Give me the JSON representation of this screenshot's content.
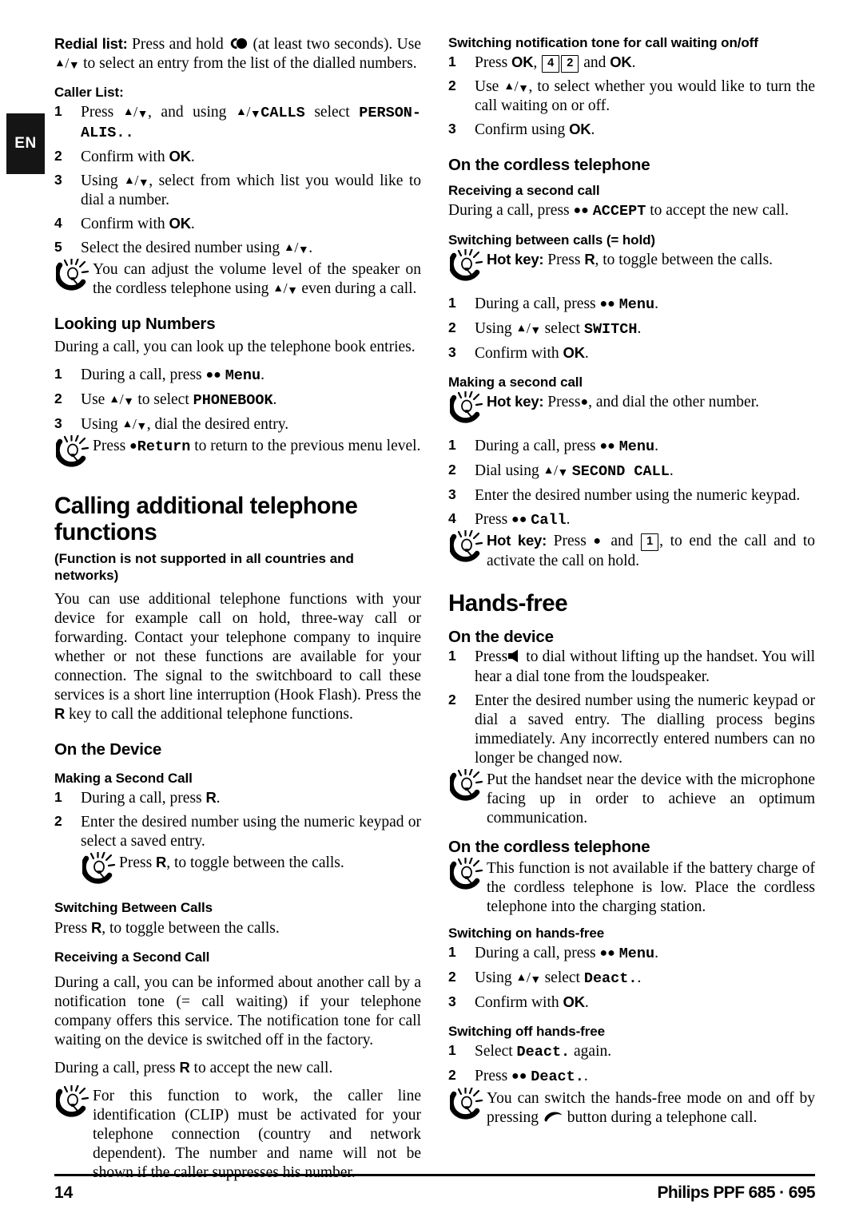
{
  "language_tab": "EN",
  "footer": {
    "page_number": "14",
    "brand": "Philips PPF 685 · 695"
  },
  "icons": {
    "bulb": "lightbulb-tip-icon",
    "redial": "redial-icon",
    "speaker": "loudspeaker-icon",
    "handset": "handset-icon"
  },
  "left_column": {
    "redial": {
      "label": "Redial list:",
      "text_before_icon": " Press and hold ",
      "text_after_icon": " (at least two seconds). Use ",
      "text_tail": " to select an entry from the list of the dialled numbers."
    },
    "caller_list": {
      "heading": "Caller List:",
      "steps": [
        {
          "num": "1",
          "parts": [
            "Press ",
            "UPDOWN",
            ", and using ",
            "UPDOWN",
            "CALLS",
            " select ",
            "PERSON-ALIS.."
          ]
        },
        {
          "num": "2",
          "text": "Confirm with ",
          "bold": "OK",
          "tail": "."
        },
        {
          "num": "3",
          "text": "Using ",
          "tail": ", select from which list you would like to dial a number."
        },
        {
          "num": "4",
          "text": "Confirm with ",
          "bold": "OK",
          "tail": "."
        },
        {
          "num": "5",
          "text": "Select the desired number using ",
          "tail": "."
        }
      ],
      "tip": {
        "part1": "You can adjust the volume level of the speaker on the cordless telephone using ",
        "part2": " even during a call."
      }
    },
    "looking_up_numbers": {
      "heading": "Looking up Numbers",
      "intro": "During a call, you can look up the telephone book entries.",
      "steps": [
        {
          "num": "1",
          "text": "During a call, press ",
          "display": "Menu",
          "tail": "."
        },
        {
          "num": "2",
          "text": "Use ",
          "mid": " to select ",
          "display": "PHONEBOOK",
          "tail": "."
        },
        {
          "num": "3",
          "text": "Using ",
          "tail": ", dial the desired entry."
        }
      ],
      "tip": {
        "before": "Press ",
        "display": "Return",
        "after": " to return to the previous menu level."
      }
    },
    "calling_additional": {
      "heading": "Calling additional telephone functions",
      "subheading": "(Function is not supported in all countries and networks)",
      "body": "You can use additional telephone functions with your device for example call on hold, three-way call or forwarding. Contact your telephone company to inquire whether or not these functions are available for your connection. The signal to the switchboard to call these services is a short line interruption (Hook Flash). Press the ",
      "body_bold": "R",
      "body_tail": " key to call the additional telephone functions."
    },
    "on_the_device": {
      "heading": "On the Device",
      "making_second_call": {
        "heading": "Making a Second Call",
        "steps": [
          {
            "num": "1",
            "text": "During a call, press ",
            "bold": "R",
            "tail": "."
          },
          {
            "num": "2",
            "text": "Enter the desired number using the numeric keypad or select a saved entry."
          }
        ],
        "tip": {
          "before": "Press ",
          "bold": "R",
          "after": ", to toggle between the calls."
        }
      },
      "switching_between_calls": {
        "heading": "Switching Between Calls",
        "text_before": "Press ",
        "bold": "R",
        "text_after": ", to toggle between the calls."
      },
      "receiving_second_call": {
        "heading": "Receiving a Second Call",
        "para1": "During a call, you can be informed about another call by a notification tone (= call waiting) if your telephone company offers this service. The notification tone for call waiting on the device is switched off in the factory.",
        "para2_before": "During a call, press ",
        "para2_bold": "R",
        "para2_after": " to accept the new call.",
        "tip": "For this function to work, the caller line identification (CLIP) must be activated for your telephone connection (country and network dependent). The number and name will not be shown if the caller suppresses his number."
      }
    }
  },
  "right_column": {
    "switching_notification_tone": {
      "heading": "Switching notification tone for call waiting on/off",
      "steps": [
        {
          "num": "1",
          "text": "Press ",
          "bold1": "OK",
          "comma": ", ",
          "key1": "4",
          "key2": "2",
          "mid": " and ",
          "bold2": "OK",
          "tail": "."
        },
        {
          "num": "2",
          "text": "Use ",
          "tail": ", to select whether you would like to turn the call waiting on or off."
        },
        {
          "num": "3",
          "text": "Confirm using ",
          "bold": "OK",
          "tail": "."
        }
      ]
    },
    "on_the_cordless_telephone_1": {
      "heading": "On the cordless telephone",
      "receiving_second_call": {
        "heading": "Receiving a second call",
        "text_before": "During a call, press ",
        "display": "ACCEPT",
        "text_after": " to accept the new call."
      },
      "switching_between_calls": {
        "heading": "Switching between calls (= hold)",
        "tip": {
          "label": "Hot key:",
          "before": " Press ",
          "bold": "R",
          "after": ", to toggle between the calls."
        },
        "steps": [
          {
            "num": "1",
            "text": "During a call, press ",
            "display": "Menu",
            "tail": "."
          },
          {
            "num": "2",
            "text": "Using ",
            "mid": " select ",
            "display": "SWITCH",
            "tail": "."
          },
          {
            "num": "3",
            "text": "Confirm with ",
            "bold": "OK",
            "tail": "."
          }
        ]
      },
      "making_second_call": {
        "heading": "Making a second call",
        "tip1": {
          "label": "Hot key:",
          "before": " Press",
          "after": ", and dial the other number."
        },
        "steps": [
          {
            "num": "1",
            "text": "During a call, press ",
            "display": "Menu",
            "tail": "."
          },
          {
            "num": "2",
            "text": "Dial using ",
            "display": "SECOND CALL",
            "tail": "."
          },
          {
            "num": "3",
            "text": "Enter the desired number using the numeric keypad."
          },
          {
            "num": "4",
            "text": "Press ",
            "display": "Call",
            "tail": "."
          }
        ],
        "tip2": {
          "label": "Hot key:",
          "before": " Press ",
          "mid": " and ",
          "key": "1",
          "after": ", to end the call and to activate the call on hold."
        }
      }
    },
    "hands_free": {
      "heading": "Hands-free",
      "on_the_device": {
        "heading": "On the device",
        "steps": [
          {
            "num": "1",
            "text": "Press",
            "tail": " to dial without lifting up the handset. You will hear a dial tone from the loudspeaker."
          },
          {
            "num": "2",
            "text": "Enter the desired number using the numeric keypad or dial a saved entry. The dialling process begins immediately. Any incorrectly entered numbers can no longer be changed now."
          }
        ],
        "tip": "Put the handset near the device with the microphone facing up in order to achieve an optimum communication."
      },
      "on_the_cordless_telephone": {
        "heading": "On the cordless telephone",
        "tip": "This function is not available if the battery charge of the cordless telephone is low. Place the cordless telephone into the charging station.",
        "switching_on": {
          "heading": "Switching on hands-free",
          "steps": [
            {
              "num": "1",
              "text": "During a call, press ",
              "display": "Menu",
              "tail": "."
            },
            {
              "num": "2",
              "text": "Using ",
              "mid": " select ",
              "display": "Deact.",
              "tail": "."
            },
            {
              "num": "3",
              "text": "Confirm with ",
              "bold": "OK",
              "tail": "."
            }
          ]
        },
        "switching_off": {
          "heading": "Switching off hands-free",
          "steps": [
            {
              "num": "1",
              "text": "Select ",
              "display": "Deact.",
              "tail": " again."
            },
            {
              "num": "2",
              "text": "Press ",
              "display": "Deact.",
              "tail": "."
            }
          ],
          "tip": {
            "before": "You can switch the hands-free mode on and off by pressing ",
            "after": " button during a telephone call."
          }
        }
      }
    }
  }
}
